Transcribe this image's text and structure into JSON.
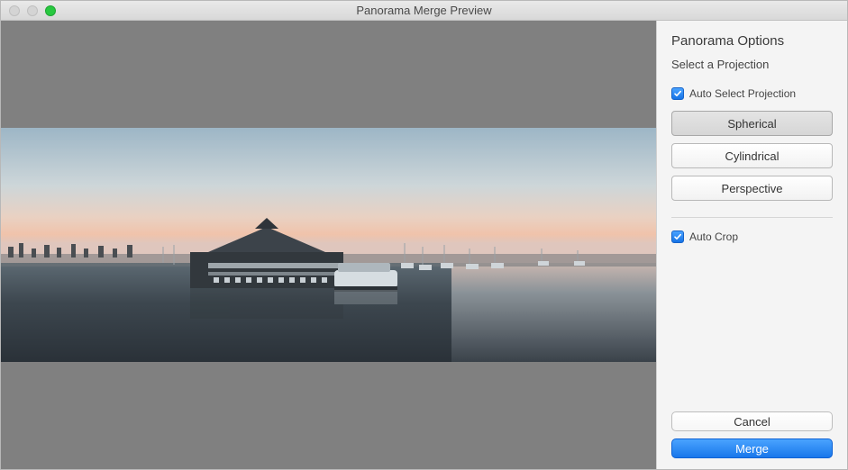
{
  "window": {
    "title": "Panorama Merge Preview"
  },
  "sidebar": {
    "heading": "Panorama Options",
    "subheading": "Select a Projection",
    "auto_select_label": "Auto Select Projection",
    "auto_select_checked": true,
    "projections": {
      "spherical": "Spherical",
      "cylindrical": "Cylindrical",
      "perspective": "Perspective",
      "selected": "spherical"
    },
    "auto_crop_label": "Auto Crop",
    "auto_crop_checked": true
  },
  "footer": {
    "cancel": "Cancel",
    "merge": "Merge"
  },
  "colors": {
    "accent": "#1877eb",
    "preview_bg": "#808080"
  }
}
